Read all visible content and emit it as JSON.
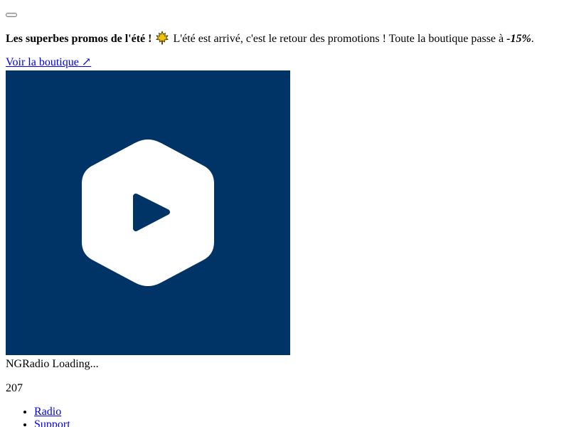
{
  "banner": {
    "close_label": "",
    "title": "Les superbes promos de l'été !",
    "emoji_icon": "maple-leaf-icon",
    "text_before": "L'été est arrivé, c'est le retour des promotions ! Toute la boutique passe à",
    "discount": "-15%",
    "text_after": ".",
    "shop_link": "Voir la boutique ↗"
  },
  "player": {
    "cover_icon": "hexagon-play-icon",
    "cover_color": "#003366",
    "station": "NGRadio",
    "status": "Loading...",
    "listeners": "207"
  },
  "nav": {
    "items": [
      {
        "label": "Radio"
      },
      {
        "label": "Support"
      }
    ]
  }
}
